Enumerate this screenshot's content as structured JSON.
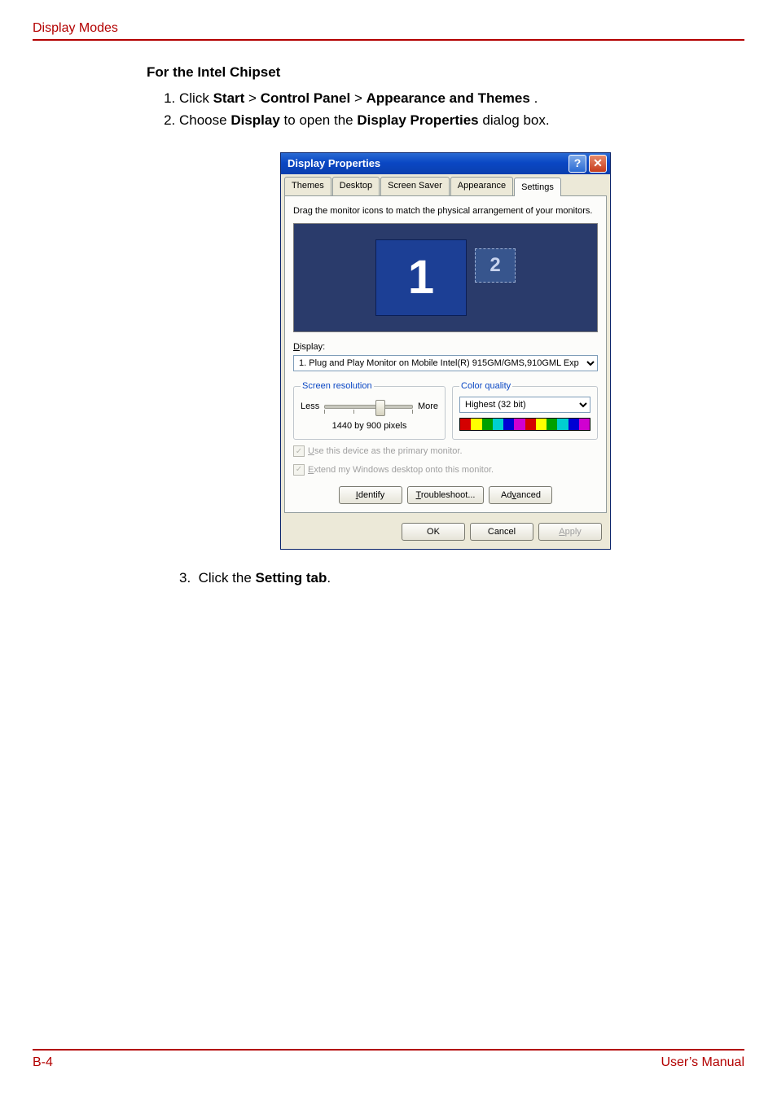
{
  "header": {
    "page_title": "Display Modes"
  },
  "body": {
    "section_heading": "For the Intel Chipset",
    "step1": {
      "prefix": "Click ",
      "b1": "Start",
      "sep": " > ",
      "b2": "Control Panel",
      "b3": "Appearance and Themes",
      "suffix": "."
    },
    "step2": {
      "prefix": "Choose ",
      "b1": "Display",
      "mid": " to open the ",
      "b2": "Display Properties",
      "suffix": " dialog box."
    },
    "step3": {
      "prefix": "Click the ",
      "b1": "Setting tab",
      "suffix": "."
    }
  },
  "dialog": {
    "title": "Display Properties",
    "help_glyph": "?",
    "close_glyph": "✕",
    "tabs": [
      "Themes",
      "Desktop",
      "Screen Saver",
      "Appearance",
      "Settings"
    ],
    "active_tab_index": 4,
    "drag_hint": "Drag the monitor icons to match the physical arrangement of your monitors.",
    "monitors": {
      "primary_label": "1",
      "secondary_label": "2"
    },
    "display_label": "Display:",
    "display_label_ul": "D",
    "display_label_rest": "isplay:",
    "display_value": "1. Plug and Play Monitor on Mobile Intel(R) 915GM/GMS,910GML Exp",
    "resolution": {
      "legend": "Screen resolution",
      "legend_ul": "S",
      "legend_rest": "creen resolution",
      "less": "Less",
      "more": "More",
      "readout": "1440 by 900 pixels",
      "slider_position_pct": 62
    },
    "color_quality": {
      "legend": "Color quality",
      "legend_ul": "C",
      "legend_rest": "olor quality",
      "value": "Highest (32 bit)",
      "colors": [
        "#d40000",
        "#ffff00",
        "#00a000",
        "#00d0d0",
        "#0000d4",
        "#d000d0",
        "#d40000",
        "#ffff00",
        "#00a000",
        "#00d0d0",
        "#0000d4",
        "#d000d0"
      ]
    },
    "checkboxes": {
      "primary_ul": "U",
      "primary_rest": "se this device as the primary monitor.",
      "extend_ul": "E",
      "extend_rest": "xtend my Windows desktop onto this monitor."
    },
    "mid_buttons": {
      "identify_ul": "I",
      "identify_rest": "dentify",
      "trouble_ul": "T",
      "trouble_rest": "roubleshoot...",
      "adv_pre": "Ad",
      "adv_ul": "v",
      "adv_rest": "anced"
    },
    "bottom_buttons": {
      "ok": "OK",
      "cancel": "Cancel",
      "apply_ul": "A",
      "apply_rest": "pply"
    }
  },
  "footer": {
    "left": "B-4",
    "right": "User’s Manual"
  }
}
